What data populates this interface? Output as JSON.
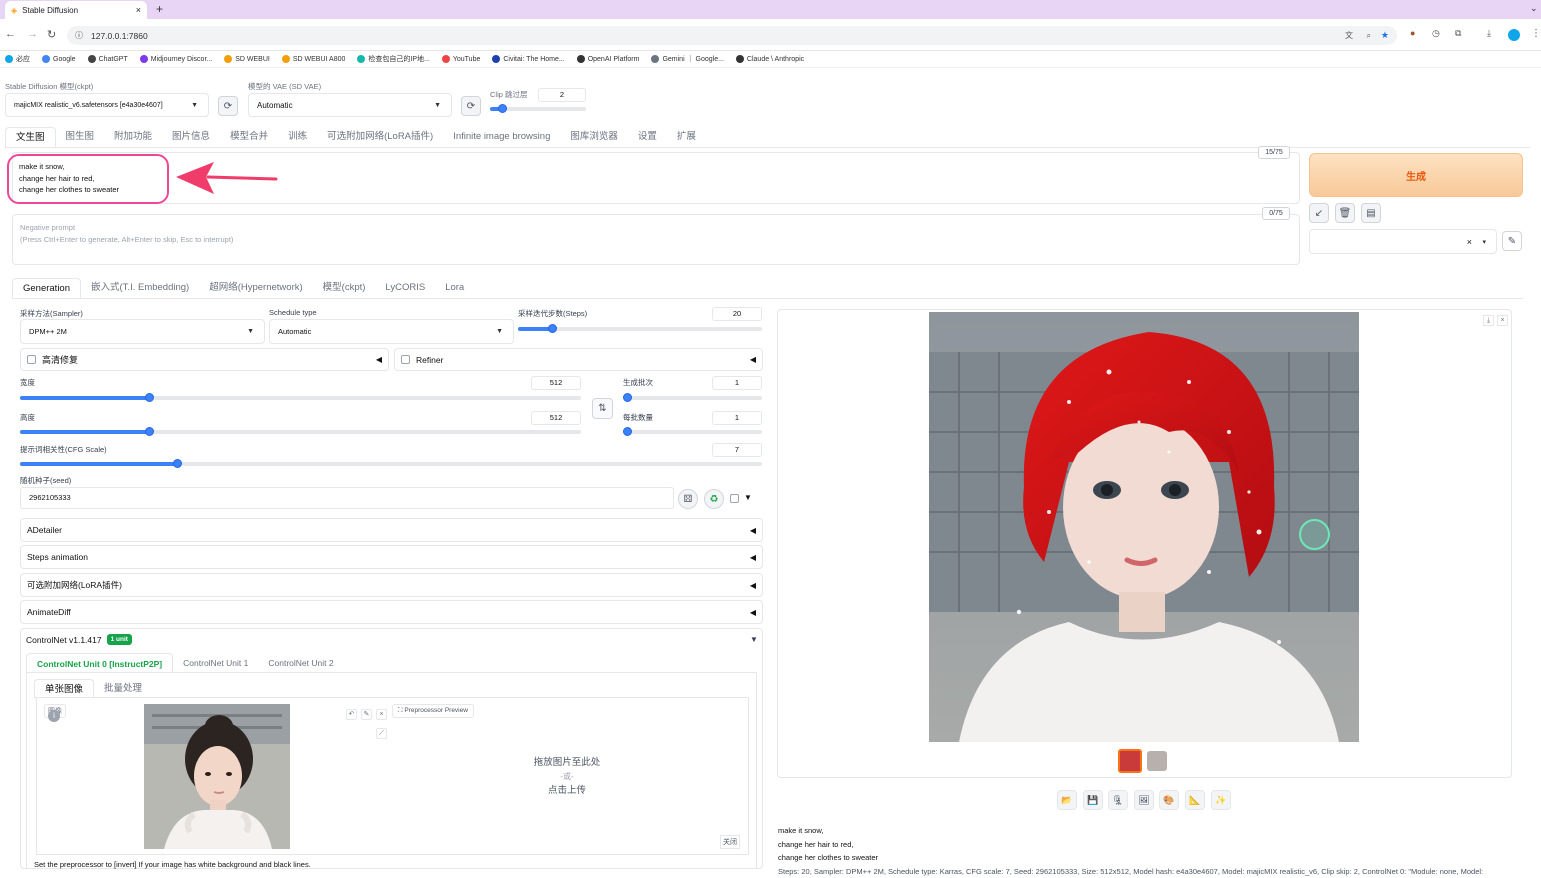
{
  "browser": {
    "tab_title": "Stable Diffusion",
    "new_tab": "+",
    "url": "127.0.0.1:7860",
    "bookmarks": [
      {
        "label": "必应",
        "color": "#0ea5e9"
      },
      {
        "label": "Google",
        "color": "#4285f4"
      },
      {
        "label": "ChatGPT",
        "color": "#444"
      },
      {
        "label": "Midjourney Discor...",
        "color": "#7c3aed"
      },
      {
        "label": "SD WEBUI",
        "color": "#f59e0b"
      },
      {
        "label": "SD WEBUI A800",
        "color": "#f59e0b"
      },
      {
        "label": "检查包自己的IP地...",
        "color": "#14b8a6"
      },
      {
        "label": "YouTube",
        "color": "#ef4444"
      },
      {
        "label": "Civitai: The Home...",
        "color": "#1e40af"
      },
      {
        "label": "OpenAI Platform",
        "color": "#333"
      },
      {
        "label": "Gemini ｜ Google...",
        "color": "#6b7280"
      },
      {
        "label": "Claude \\ Anthropic",
        "color": "#333"
      }
    ]
  },
  "top": {
    "model_label": "Stable Diffusion 模型(ckpt)",
    "model_value": "majicMIX realistic_v6.safetensors [e4a30e4607]",
    "vae_label": "模型的 VAE (SD VAE)",
    "vae_value": "Automatic",
    "clip_label": "Clip 跳过层",
    "clip_value": "2",
    "clip_fraction": 0.08
  },
  "main_tabs": [
    "文生图",
    "图生图",
    "附加功能",
    "图片信息",
    "模型合并",
    "训练",
    "可选附加网络(LoRA插件)",
    "Infinite image browsing",
    "图库浏览器",
    "设置",
    "扩展"
  ],
  "prompt": {
    "line1": "make it snow,",
    "line2": "change her hair to red,",
    "line3": "change her clothes to sweater",
    "token_count": "15/75",
    "neg_placeholder_1": "Negative prompt",
    "neg_placeholder_2": "(Press Ctrl+Enter to generate, Alt+Enter to skip, Esc to interrupt)",
    "neg_token_count": "0/75"
  },
  "generate_label": "生成",
  "sub_tabs": [
    "Generation",
    "嵌入式(T.I. Embedding)",
    "超网络(Hypernetwork)",
    "模型(ckpt)",
    "LyCORIS",
    "Lora"
  ],
  "params": {
    "sampler_label": "采样方法(Sampler)",
    "sampler_value": "DPM++ 2M",
    "schedule_label": "Schedule type",
    "schedule_value": "Automatic",
    "steps_label": "采样迭代步数(Steps)",
    "steps_value": "20",
    "hires_label": "高清修复",
    "refiner_label": "Refiner",
    "width_label": "宽度",
    "width_value": "512",
    "height_label": "高度",
    "height_value": "512",
    "batch_count_label": "生成批次",
    "batch_count_value": "1",
    "batch_size_label": "每批数量",
    "batch_size_value": "1",
    "cfg_label": "提示词相关性(CFG Scale)",
    "cfg_value": "7",
    "seed_label": "随机种子(seed)",
    "seed_value": "2962105333"
  },
  "accordions": [
    "ADetailer",
    "Steps animation",
    "可选附加网络(LoRA插件)",
    "AnimateDiff"
  ],
  "controlnet": {
    "title": "ControlNet v1.1.417",
    "badge": "1 unit",
    "units": [
      "ControlNet Unit 0 [InstructP2P]",
      "ControlNet Unit 1",
      "ControlNet Unit 2"
    ],
    "mode_tabs": [
      "单张图像",
      "批量处理"
    ],
    "image_label": "图像",
    "preview_btn": "Preprocessor Preview",
    "drop_1": "拖放图片至此处",
    "drop_2": "-或-",
    "drop_3": "点击上传",
    "close_label": "关闭",
    "hint": "Set the preprocessor to [invert] If your image has white background and black lines."
  },
  "output": {
    "caption_1": "make it snow,",
    "caption_2": "change her hair to red,",
    "caption_3": "change her clothes to sweater",
    "caption_4": "Steps: 20, Sampler: DPM++ 2M, Schedule type: Karras, CFG scale: 7, Seed: 2962105333, Size: 512x512, Model hash: e4a30e4607, Model: majicMIX realistic_v6, Clip skip: 2, ControlNet 0: \"Module: none, Model:"
  },
  "colors": {
    "accent": "#3b82f6",
    "generate_bg": "#fbd8b0",
    "generate_text": "#ea580c",
    "highlight": "#ec4899",
    "badge": "#16a34a"
  }
}
